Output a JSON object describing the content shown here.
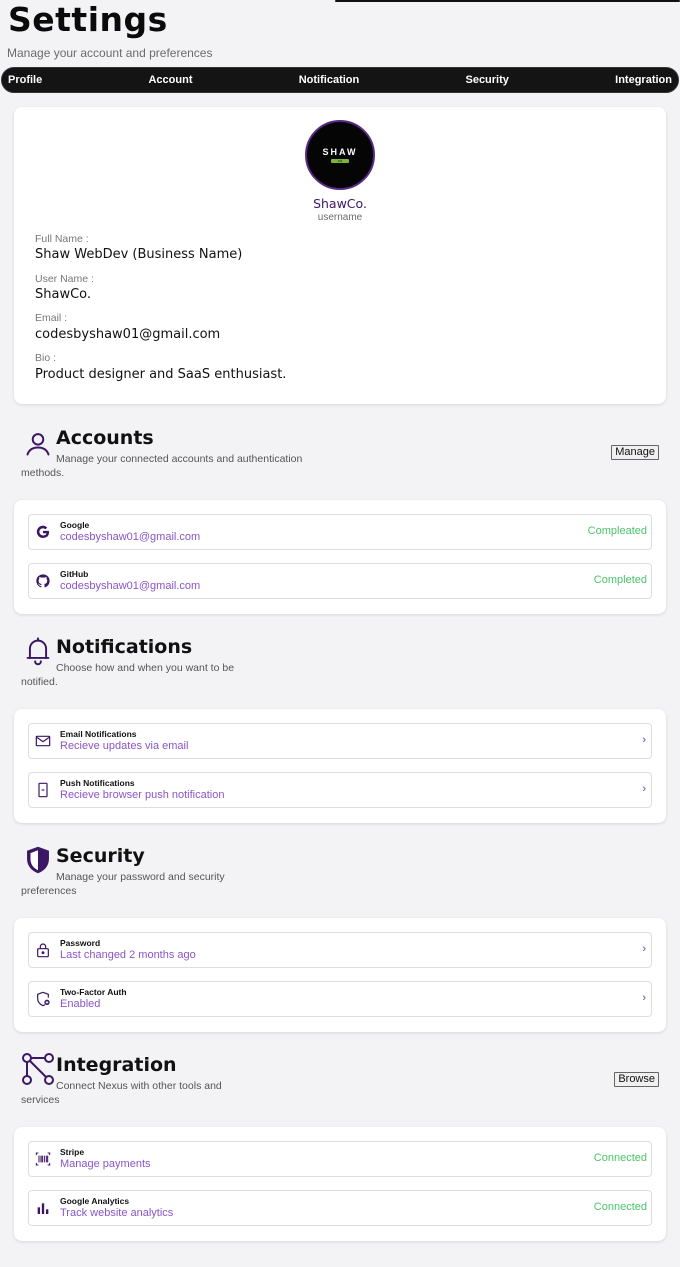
{
  "page": {
    "title": "Settings",
    "subtitle": "Manage your account and preferences"
  },
  "tabs": [
    {
      "label": "Profile"
    },
    {
      "label": "Account"
    },
    {
      "label": "Notification"
    },
    {
      "label": "Security"
    },
    {
      "label": "Integration"
    }
  ],
  "profile": {
    "avatar_logo": "SHAW",
    "avatar_logo_sub": "CO",
    "display_name": "ShawCo.",
    "display_sub": "username",
    "fields": [
      {
        "label": "Full Name :",
        "value": "Shaw WebDev (Business Name)"
      },
      {
        "label": "User Name :",
        "value": "ShawCo."
      },
      {
        "label": "Email :",
        "value": "codesbyshaw01@gmail.com"
      },
      {
        "label": "Bio :",
        "value": "Product designer and SaaS enthusiast."
      }
    ]
  },
  "accounts": {
    "title": "Accounts",
    "desc_line1": "Manage your connected accounts and authentication",
    "desc_line2": "methods.",
    "button": "Manage",
    "items": [
      {
        "icon": "google-icon",
        "title": "Google",
        "sub": "codesbyshaw01@gmail.com",
        "status": "Compleated"
      },
      {
        "icon": "github-icon",
        "title": "GitHub",
        "sub": "codesbyshaw01@gmail.com",
        "status": "Completed"
      }
    ]
  },
  "notifications": {
    "title": "Notifications",
    "desc_line1": "Choose how and when you want to be",
    "desc_line2": "notified.",
    "items": [
      {
        "icon": "mail-icon",
        "title": "Email Notifications",
        "sub": "Recieve updates via email",
        "chevron": "›"
      },
      {
        "icon": "phone-icon",
        "title": "Push Notifications",
        "sub": "Recieve browser push notification",
        "chevron": "›"
      }
    ]
  },
  "security": {
    "title": "Security",
    "desc_line1": "Manage your password and security",
    "desc_line2": "preferences",
    "items": [
      {
        "icon": "lock-icon",
        "title": "Password",
        "sub": "Last changed 2 months ago",
        "chevron": "›"
      },
      {
        "icon": "shield-plus-icon",
        "title": "Two-Factor Auth",
        "sub": "Enabled",
        "chevron": "›"
      }
    ]
  },
  "integration": {
    "title": "Integration",
    "desc_line1": "Connect Nexus with other tools and",
    "desc_line2": "services",
    "button": "Browse",
    "items": [
      {
        "icon": "barcode-icon",
        "title": "Stripe",
        "sub": "Manage payments",
        "status": "Connected"
      },
      {
        "icon": "bar-chart-icon",
        "title": "Google Analytics",
        "sub": "Track website analytics",
        "status": "Connected"
      }
    ]
  },
  "colors": {
    "accent": "#3b1764",
    "accent_light": "#8a55c7",
    "success": "#4cc46a",
    "tabbar_bg": "#141414"
  }
}
